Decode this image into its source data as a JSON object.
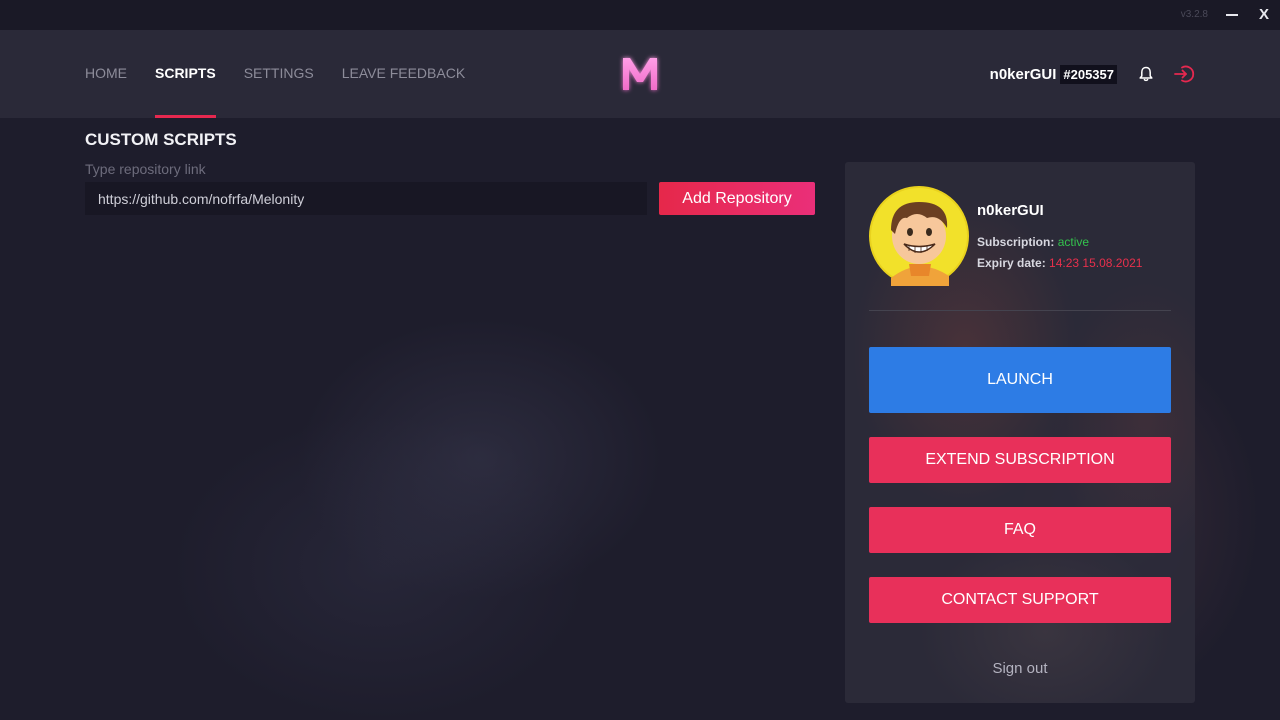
{
  "window": {
    "version": "v3.2.8",
    "minimize_label": "—",
    "close_label": "X"
  },
  "nav": {
    "items": [
      {
        "label": "HOME",
        "active": false
      },
      {
        "label": "SCRIPTS",
        "active": true
      },
      {
        "label": "SETTINGS",
        "active": false
      },
      {
        "label": "LEAVE FEEDBACK",
        "active": false
      }
    ]
  },
  "header": {
    "username": "n0kerGUI",
    "user_id": "#205357"
  },
  "scripts": {
    "title": "CUSTOM SCRIPTS",
    "repo_label": "Type repository link",
    "repo_value": "https://github.com/nofrfa/Melonity",
    "add_button": "Add Repository"
  },
  "profile": {
    "name": "n0kerGUI",
    "subscription_label": "Subscription:",
    "subscription_value": "active",
    "expiry_label": "Expiry date:",
    "expiry_value": "14:23 15.08.2021"
  },
  "actions": {
    "launch": "LAUNCH",
    "extend": "EXTEND SUBSCRIPTION",
    "faq": "FAQ",
    "support": "CONTACT SUPPORT",
    "signout": "Sign out"
  },
  "colors": {
    "accent_red": "#e6284f",
    "launch_blue": "#2d7ce5",
    "active_green": "#33c24d"
  },
  "icons": {
    "logo": "melonity-m-logo",
    "bell": "bell-icon",
    "logout": "logout-icon",
    "avatar": "cartoon-avatar"
  }
}
